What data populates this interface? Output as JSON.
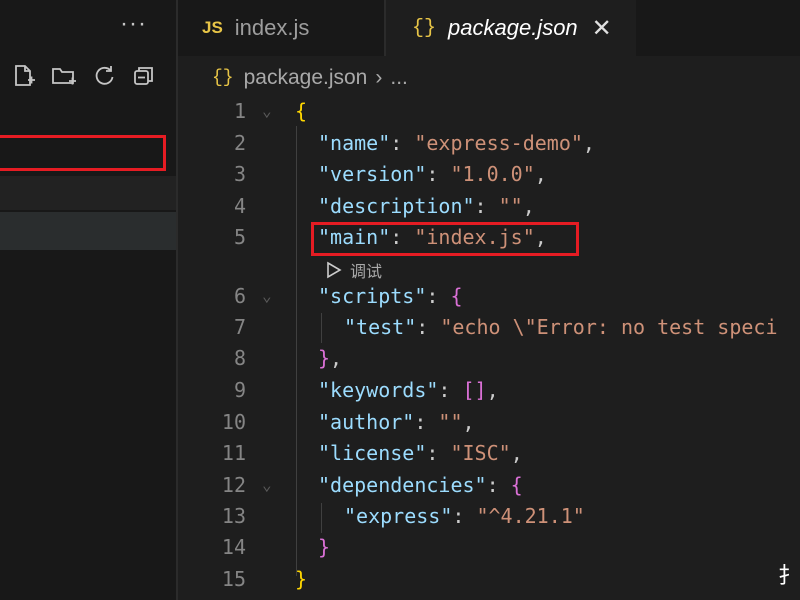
{
  "sidebar": {
    "more_label": "···"
  },
  "tabs": [
    {
      "badge": "JS",
      "label": "index.js"
    },
    {
      "badge": "{}",
      "label": "package.json",
      "close": "✕"
    }
  ],
  "breadcrumb": {
    "icon": "{}",
    "file": "package.json",
    "sep": "›",
    "more": "..."
  },
  "codelens": {
    "label": "调试"
  },
  "lines": [
    {
      "n": "1",
      "segments": [
        {
          "t": "{",
          "c": "b1"
        }
      ]
    },
    {
      "n": "2",
      "segments": [
        {
          "t": "\"name\"",
          "c": "k"
        },
        {
          "t": ": ",
          "c": "p"
        },
        {
          "t": "\"express-demo\"",
          "c": "s"
        },
        {
          "t": ",",
          "c": "p"
        }
      ]
    },
    {
      "n": "3",
      "segments": [
        {
          "t": "\"version\"",
          "c": "k"
        },
        {
          "t": ": ",
          "c": "p"
        },
        {
          "t": "\"1.0.0\"",
          "c": "s"
        },
        {
          "t": ",",
          "c": "p"
        }
      ]
    },
    {
      "n": "4",
      "segments": [
        {
          "t": "\"description\"",
          "c": "k"
        },
        {
          "t": ": ",
          "c": "p"
        },
        {
          "t": "\"\"",
          "c": "s"
        },
        {
          "t": ",",
          "c": "p"
        }
      ]
    },
    {
      "n": "5",
      "segments": [
        {
          "t": "\"main\"",
          "c": "k"
        },
        {
          "t": ": ",
          "c": "p"
        },
        {
          "t": "\"index.js\"",
          "c": "s"
        },
        {
          "t": ",",
          "c": "p"
        }
      ]
    },
    {
      "n": "6",
      "segments": [
        {
          "t": "\"scripts\"",
          "c": "k"
        },
        {
          "t": ": ",
          "c": "p"
        },
        {
          "t": "{",
          "c": "b2"
        }
      ]
    },
    {
      "n": "7",
      "segments": [
        {
          "t": "\"test\"",
          "c": "k"
        },
        {
          "t": ": ",
          "c": "p"
        },
        {
          "t": "\"echo \\\"Error: no test speci",
          "c": "s"
        }
      ]
    },
    {
      "n": "8",
      "segments": [
        {
          "t": "}",
          "c": "b2"
        },
        {
          "t": ",",
          "c": "p"
        }
      ]
    },
    {
      "n": "9",
      "segments": [
        {
          "t": "\"keywords\"",
          "c": "k"
        },
        {
          "t": ": ",
          "c": "p"
        },
        {
          "t": "[]",
          "c": "b2"
        },
        {
          "t": ",",
          "c": "p"
        }
      ]
    },
    {
      "n": "10",
      "segments": [
        {
          "t": "\"author\"",
          "c": "k"
        },
        {
          "t": ": ",
          "c": "p"
        },
        {
          "t": "\"\"",
          "c": "s"
        },
        {
          "t": ",",
          "c": "p"
        }
      ]
    },
    {
      "n": "11",
      "segments": [
        {
          "t": "\"license\"",
          "c": "k"
        },
        {
          "t": ": ",
          "c": "p"
        },
        {
          "t": "\"ISC\"",
          "c": "s"
        },
        {
          "t": ",",
          "c": "p"
        }
      ]
    },
    {
      "n": "12",
      "segments": [
        {
          "t": "\"dependencies\"",
          "c": "k"
        },
        {
          "t": ": ",
          "c": "p"
        },
        {
          "t": "{",
          "c": "b2"
        }
      ]
    },
    {
      "n": "13",
      "segments": [
        {
          "t": "\"express\"",
          "c": "k"
        },
        {
          "t": ": ",
          "c": "p"
        },
        {
          "t": "\"^4.21.1\"",
          "c": "s"
        }
      ]
    },
    {
      "n": "14",
      "segments": [
        {
          "t": "}",
          "c": "b2"
        }
      ]
    },
    {
      "n": "15",
      "segments": [
        {
          "t": "}",
          "c": "b1"
        }
      ]
    }
  ],
  "corner_glyph": "扌",
  "colors": {
    "highlight_box": "#e51c23",
    "json_icon": "#e8c547",
    "key": "#9cdcfe",
    "string": "#ce9178"
  }
}
